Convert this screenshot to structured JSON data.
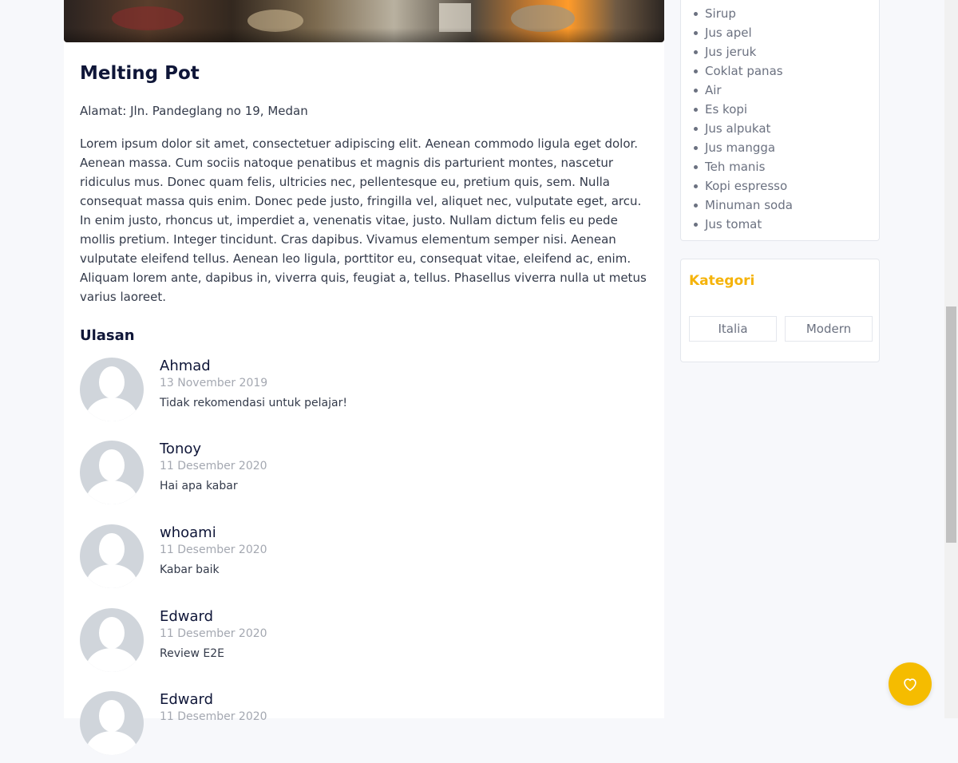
{
  "restaurant": {
    "name": "Melting Pot",
    "address": "Alamat: Jln. Pandeglang no 19, Medan",
    "description": "Lorem ipsum dolor sit amet, consectetuer adipiscing elit. Aenean commodo ligula eget dolor. Aenean massa. Cum sociis natoque penatibus et magnis dis parturient montes, nascetur ridiculus mus. Donec quam felis, ultricies nec, pellentesque eu, pretium quis, sem. Nulla consequat massa quis enim. Donec pede justo, fringilla vel, aliquet nec, vulputate eget, arcu. In enim justo, rhoncus ut, imperdiet a, venenatis vitae, justo. Nullam dictum felis eu pede mollis pretium. Integer tincidunt. Cras dapibus. Vivamus elementum semper nisi. Aenean vulputate eleifend tellus. Aenean leo ligula, porttitor eu, consequat vitae, eleifend ac, enim. Aliquam lorem ante, dapibus in, viverra quis, feugiat a, tellus. Phasellus viverra nulla ut metus varius laoreet."
  },
  "reviews": {
    "title": "Ulasan",
    "items": [
      {
        "name": "Ahmad",
        "date": "13 November 2019",
        "text": "Tidak rekomendasi untuk pelajar!"
      },
      {
        "name": "Tonoy",
        "date": "11 Desember 2020",
        "text": "Hai apa kabar"
      },
      {
        "name": "whoami",
        "date": "11 Desember 2020",
        "text": "Kabar baik"
      },
      {
        "name": "Edward",
        "date": "11 Desember 2020",
        "text": "Review E2E"
      },
      {
        "name": "Edward",
        "date": "11 Desember 2020",
        "text": ""
      }
    ]
  },
  "drinks": [
    "Sirup",
    "Jus apel",
    "Jus jeruk",
    "Coklat panas",
    "Air",
    "Es kopi",
    "Jus alpukat",
    "Jus mangga",
    "Teh manis",
    "Kopi espresso",
    "Minuman soda",
    "Jus tomat"
  ],
  "categories": {
    "title": "Kategori",
    "items": [
      "Italia",
      "Modern"
    ]
  },
  "colors": {
    "accent": "#f5bc00",
    "category_title": "#f5b30a",
    "heading": "#0f1638"
  },
  "fab": {
    "icon": "heart-icon"
  }
}
